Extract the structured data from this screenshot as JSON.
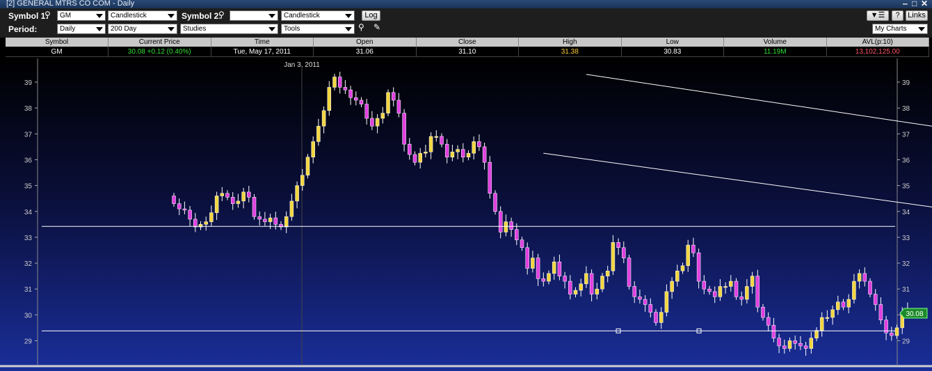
{
  "window": {
    "title": "[2] GENERAL MTRS CO COM - Daily",
    "controls": [
      "‒",
      "□",
      "✕"
    ]
  },
  "toolbar": {
    "symbol1_label": "Symbol 1:",
    "symbol1_value": "GM",
    "chart_type1": "Candlestick",
    "symbol2_label": "Symbol 2:",
    "symbol2_value": "",
    "chart_type2": "Candlestick",
    "log_label": "Log",
    "period_label": "Period:",
    "period_value": "Daily",
    "range_value": "200 Day",
    "studies_value": "Studies",
    "tools_value": "Tools",
    "help_label": "?",
    "links_label": "Links",
    "mycharts_value": "My Charts"
  },
  "quote": {
    "headers": [
      "Symbol",
      "Current Price",
      "Time",
      "Open",
      "Close",
      "High",
      "Low",
      "Volume",
      "AVL(p:10)"
    ],
    "values": [
      "GM",
      "30.08  +0.12 (0.40%)",
      "Tue, May 17, 2011",
      "31.06",
      "31.10",
      "31.38",
      "30.83",
      "11.19M",
      "13,102,125.00"
    ],
    "colors": [
      "#ffffff",
      "#33dd33",
      "#ffffff",
      "#ffffff",
      "#ffffff",
      "#ffcc33",
      "#ffffff",
      "#33dd33",
      "#ff5566"
    ]
  },
  "chart_data": {
    "type": "candlestick",
    "date_marker": "Jan 3, 2011",
    "y_ticks": [
      29,
      30,
      31,
      32,
      33,
      34,
      35,
      36,
      37,
      38,
      39
    ],
    "ylim": [
      28.2,
      39.6
    ],
    "last_price_label": "30.08",
    "colors": {
      "up": "#f2d640",
      "down": "#e040e0",
      "wick": "#ffffff",
      "grid_line": "#ffffff"
    },
    "horizontal_lines": [
      33.42,
      29.38
    ],
    "trend_lines": [
      {
        "from": [
          77,
          39.3
        ],
        "to": [
          346,
          30.95
        ]
      },
      {
        "from": [
          69,
          36.25
        ],
        "to": [
          345,
          28.35
        ]
      }
    ],
    "closes": [
      34.3,
      34.1,
      34.05,
      33.7,
      33.4,
      33.5,
      33.6,
      33.95,
      34.6,
      34.7,
      34.55,
      34.3,
      34.4,
      34.75,
      34.55,
      33.8,
      33.7,
      33.6,
      33.75,
      33.5,
      33.4,
      33.8,
      34.4,
      35.0,
      35.4,
      36.1,
      36.7,
      37.3,
      37.9,
      38.8,
      39.2,
      38.8,
      38.7,
      38.4,
      38.3,
      38.15,
      37.6,
      37.3,
      37.6,
      37.8,
      38.6,
      38.3,
      37.8,
      36.6,
      36.2,
      35.9,
      36.25,
      36.3,
      36.9,
      36.9,
      36.6,
      36.1,
      36.3,
      36.4,
      36.1,
      36.25,
      36.7,
      36.5,
      35.9,
      34.7,
      34.0,
      33.2,
      33.6,
      33.3,
      32.9,
      32.6,
      31.8,
      32.2,
      31.4,
      31.3,
      31.6,
      32.05,
      31.5,
      31.3,
      30.8,
      30.95,
      31.2,
      31.6,
      30.8,
      31.0,
      31.5,
      31.7,
      32.8,
      32.6,
      32.2,
      31.1,
      30.7,
      30.6,
      30.4,
      30.1,
      29.7,
      30.1,
      30.9,
      31.3,
      31.7,
      31.9,
      32.7,
      32.4,
      31.3,
      31.0,
      30.9,
      30.7,
      31.1,
      31.1,
      31.3,
      30.7,
      30.6,
      31.1,
      31.5,
      30.3,
      29.9,
      29.6,
      29.1,
      28.8,
      28.7,
      29.0,
      28.9,
      28.8,
      28.7,
      29.1,
      29.4,
      29.9,
      29.9,
      30.2,
      30.5,
      30.3,
      30.6,
      31.3,
      31.6,
      31.3,
      30.8,
      30.4,
      29.8,
      29.3,
      29.2,
      29.5,
      30.1,
      30.2
    ]
  }
}
